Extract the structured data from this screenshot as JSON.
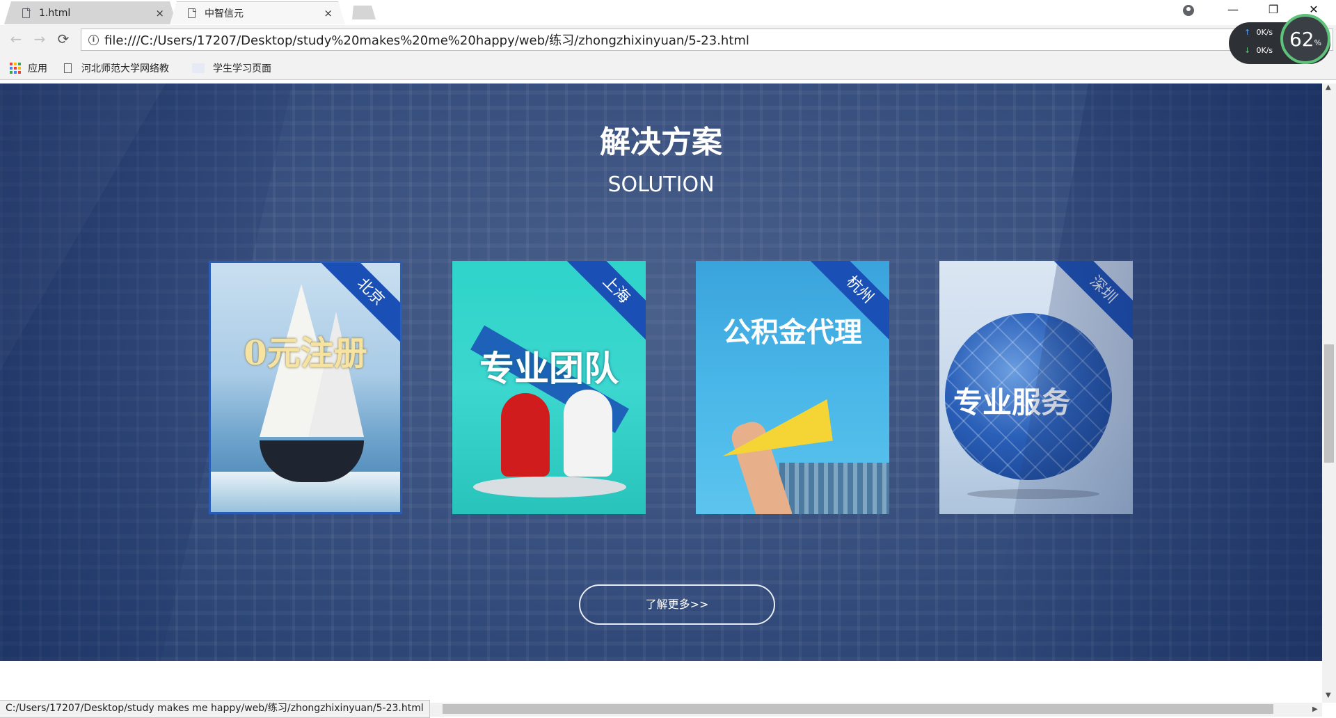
{
  "tabs": [
    {
      "title": "1.html",
      "close": "×"
    },
    {
      "title": "中智信元",
      "close": "×"
    }
  ],
  "window": {
    "minimize": "—",
    "restore": "❐",
    "close": "✕"
  },
  "toolbar": {
    "back": "←",
    "forward": "→",
    "reload": "⟳",
    "info": "i",
    "url": "file:///C:/Users/17207/Desktop/study%20makes%20me%20happy/web/练习/zhongzhixinyuan/5-23.html"
  },
  "bookmarks": {
    "apps_label": "应用",
    "items": [
      "河北师范大学网络教",
      "学生学习页面"
    ],
    "apps_colors": [
      "#ea4335",
      "#fbbc05",
      "#34a853",
      "#4285f4",
      "#ea4335",
      "#fbbc05",
      "#34a853",
      "#4285f4",
      "#ea4335"
    ]
  },
  "speed_widget": {
    "up": "0K/s",
    "down": "0K/s",
    "percent": "62",
    "percent_unit": "%"
  },
  "section": {
    "title": "解决方案",
    "subtitle": "SOLUTION"
  },
  "cards": [
    {
      "city": "北京",
      "caption": "0元注册"
    },
    {
      "city": "上海",
      "caption": "专业团队"
    },
    {
      "city": "杭州",
      "caption": "公积金代理"
    },
    {
      "city": "深圳",
      "caption": "专业服务"
    }
  ],
  "more_button": "了解更多>>",
  "status_bar": "C:/Users/17207/Desktop/study makes me happy/web/练习/zhongzhixinyuan/5-23.html",
  "colors": {
    "hero_bg": "#3a5180",
    "ribbon": "#1a4fb5",
    "selected_border": "#2a5db8"
  }
}
